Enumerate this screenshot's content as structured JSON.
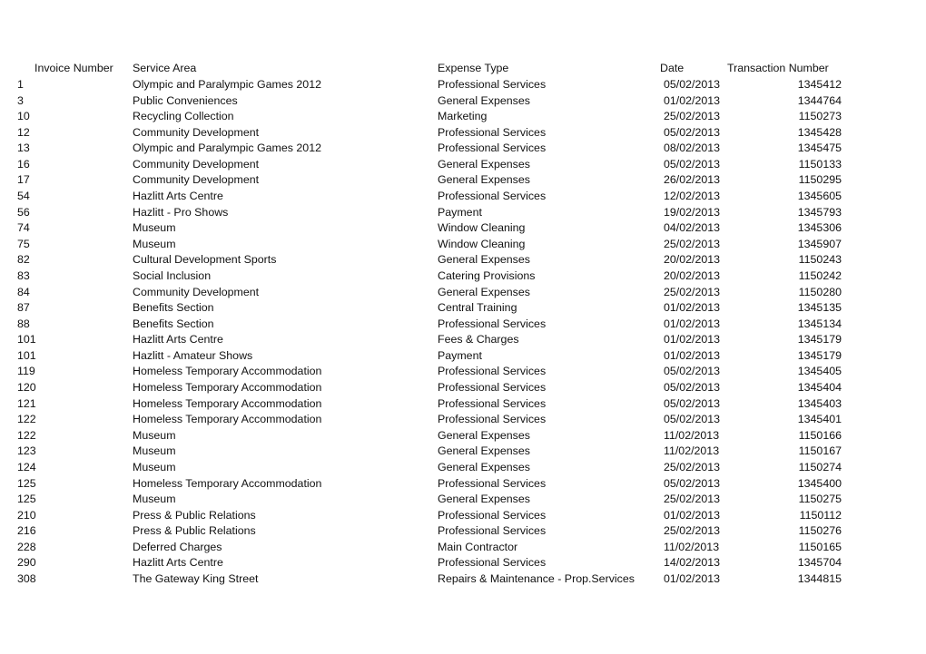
{
  "headers": {
    "invoice_number": "Invoice Number",
    "service_area": "Service Area",
    "expense_type": "Expense Type",
    "date": "Date",
    "transaction_number": "Transaction Number"
  },
  "rows": [
    {
      "invoice": "1",
      "service": "Olympic and Paralympic Games 2012",
      "expense": "Professional Services",
      "date": "05/02/2013",
      "txn": "1345412"
    },
    {
      "invoice": "3",
      "service": "Public Conveniences",
      "expense": "General Expenses",
      "date": "01/02/2013",
      "txn": "1344764"
    },
    {
      "invoice": "10",
      "service": "Recycling Collection",
      "expense": "Marketing",
      "date": "25/02/2013",
      "txn": "1150273"
    },
    {
      "invoice": "12",
      "service": "Community Development",
      "expense": "Professional Services",
      "date": "05/02/2013",
      "txn": "1345428"
    },
    {
      "invoice": "13",
      "service": "Olympic and Paralympic Games 2012",
      "expense": "Professional Services",
      "date": "08/02/2013",
      "txn": "1345475"
    },
    {
      "invoice": "16",
      "service": "Community Development",
      "expense": "General Expenses",
      "date": "05/02/2013",
      "txn": "1150133"
    },
    {
      "invoice": "17",
      "service": "Community Development",
      "expense": "General Expenses",
      "date": "26/02/2013",
      "txn": "1150295"
    },
    {
      "invoice": "54",
      "service": "Hazlitt Arts Centre",
      "expense": "Professional Services",
      "date": "12/02/2013",
      "txn": "1345605"
    },
    {
      "invoice": "56",
      "service": "Hazlitt - Pro Shows",
      "expense": "Payment",
      "date": "19/02/2013",
      "txn": "1345793"
    },
    {
      "invoice": "74",
      "service": "Museum",
      "expense": "Window Cleaning",
      "date": "04/02/2013",
      "txn": "1345306"
    },
    {
      "invoice": "75",
      "service": "Museum",
      "expense": "Window Cleaning",
      "date": "25/02/2013",
      "txn": "1345907"
    },
    {
      "invoice": "82",
      "service": "Cultural Development Sports",
      "expense": "General Expenses",
      "date": "20/02/2013",
      "txn": "1150243"
    },
    {
      "invoice": "83",
      "service": "Social Inclusion",
      "expense": "Catering Provisions",
      "date": "20/02/2013",
      "txn": "1150242"
    },
    {
      "invoice": "84",
      "service": "Community Development",
      "expense": "General Expenses",
      "date": "25/02/2013",
      "txn": "1150280"
    },
    {
      "invoice": "87",
      "service": "Benefits Section",
      "expense": "Central Training",
      "date": "01/02/2013",
      "txn": "1345135"
    },
    {
      "invoice": "88",
      "service": "Benefits Section",
      "expense": "Professional Services",
      "date": "01/02/2013",
      "txn": "1345134"
    },
    {
      "invoice": "101",
      "service": "Hazlitt Arts Centre",
      "expense": "Fees & Charges",
      "date": "01/02/2013",
      "txn": "1345179"
    },
    {
      "invoice": "101",
      "service": "Hazlitt - Amateur Shows",
      "expense": "Payment",
      "date": "01/02/2013",
      "txn": "1345179"
    },
    {
      "invoice": "119",
      "service": "Homeless Temporary Accommodation",
      "expense": "Professional Services",
      "date": "05/02/2013",
      "txn": "1345405"
    },
    {
      "invoice": "120",
      "service": "Homeless Temporary Accommodation",
      "expense": "Professional Services",
      "date": "05/02/2013",
      "txn": "1345404"
    },
    {
      "invoice": "121",
      "service": "Homeless Temporary Accommodation",
      "expense": "Professional Services",
      "date": "05/02/2013",
      "txn": "1345403"
    },
    {
      "invoice": "122",
      "service": "Homeless Temporary Accommodation",
      "expense": "Professional Services",
      "date": "05/02/2013",
      "txn": "1345401"
    },
    {
      "invoice": "122",
      "service": "Museum",
      "expense": "General Expenses",
      "date": "11/02/2013",
      "txn": "1150166"
    },
    {
      "invoice": "123",
      "service": "Museum",
      "expense": "General Expenses",
      "date": "11/02/2013",
      "txn": "1150167"
    },
    {
      "invoice": "124",
      "service": "Museum",
      "expense": "General Expenses",
      "date": "25/02/2013",
      "txn": "1150274"
    },
    {
      "invoice": "125",
      "service": "Homeless Temporary Accommodation",
      "expense": "Professional Services",
      "date": "05/02/2013",
      "txn": "1345400"
    },
    {
      "invoice": "125",
      "service": "Museum",
      "expense": "General Expenses",
      "date": "25/02/2013",
      "txn": "1150275"
    },
    {
      "invoice": "210",
      "service": "Press & Public Relations",
      "expense": "Professional Services",
      "date": "01/02/2013",
      "txn": "1150112"
    },
    {
      "invoice": "216",
      "service": "Press & Public Relations",
      "expense": "Professional Services",
      "date": "25/02/2013",
      "txn": "1150276"
    },
    {
      "invoice": "228",
      "service": "Deferred Charges",
      "expense": "Main Contractor",
      "date": "11/02/2013",
      "txn": "1150165"
    },
    {
      "invoice": "290",
      "service": "Hazlitt Arts Centre",
      "expense": "Professional Services",
      "date": "14/02/2013",
      "txn": "1345704"
    },
    {
      "invoice": "308",
      "service": "The Gateway King Street",
      "expense": "Repairs & Maintenance - Prop.Services",
      "date": "01/02/2013",
      "txn": "1344815"
    }
  ]
}
